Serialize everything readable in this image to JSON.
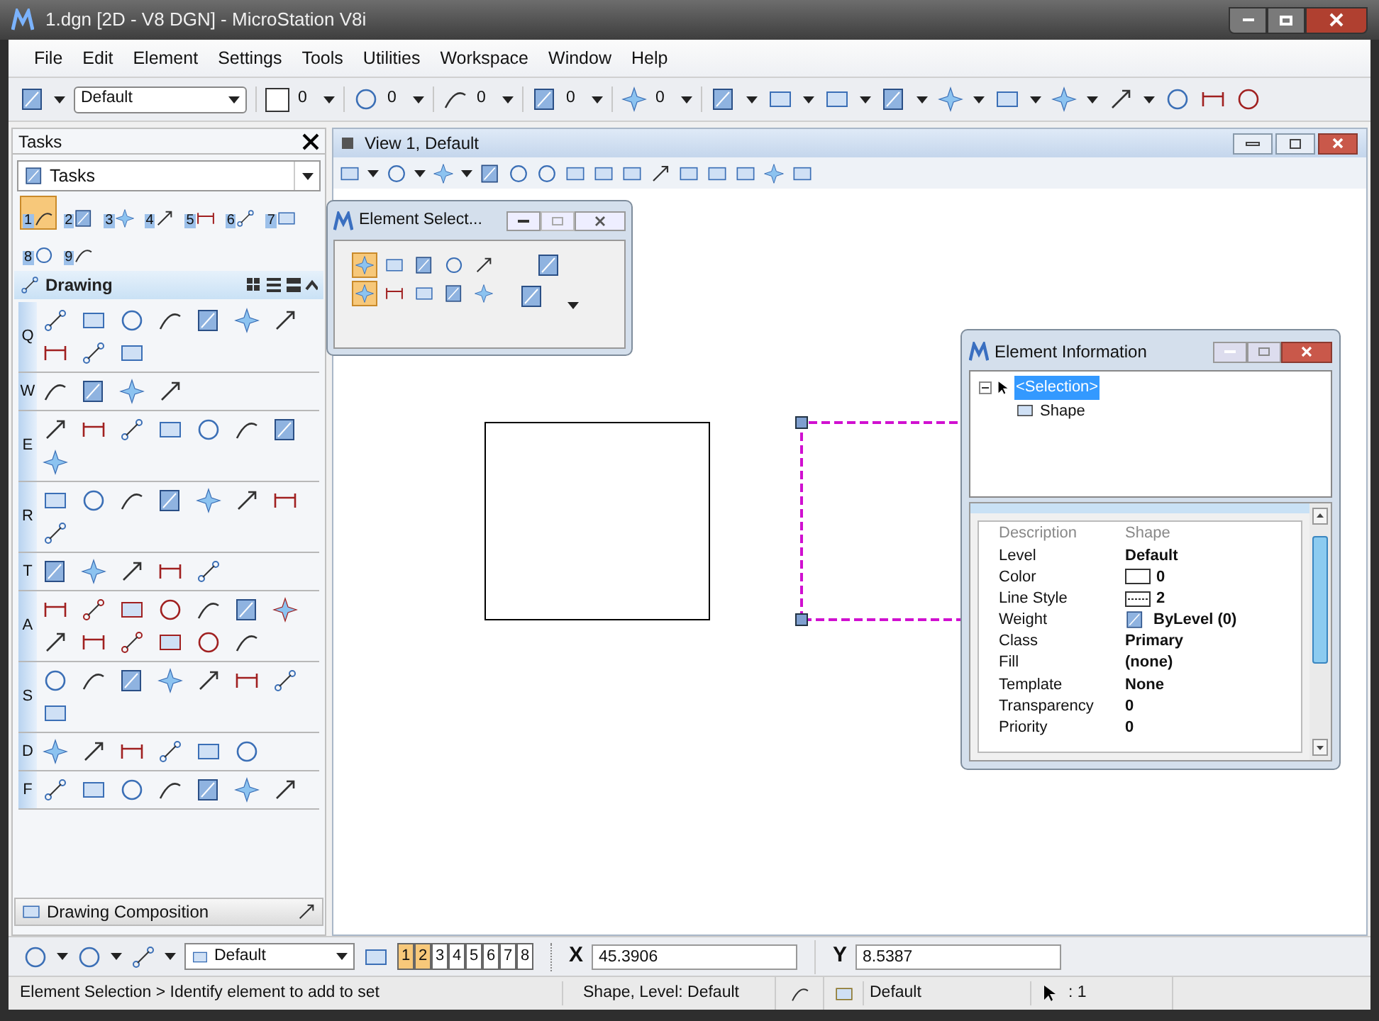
{
  "window": {
    "title": "1.dgn [2D - V8 DGN] - MicroStation V8i"
  },
  "menu": [
    "File",
    "Edit",
    "Element",
    "Settings",
    "Tools",
    "Utilities",
    "Workspace",
    "Window",
    "Help"
  ],
  "attributes": {
    "level": "Default",
    "values": [
      "0",
      "0",
      "0",
      "0",
      "0"
    ]
  },
  "tasks": {
    "title": "Tasks",
    "dropdown": "Tasks",
    "main_tools": [
      {
        "label": "1",
        "selected": true
      },
      {
        "label": "2",
        "selected": false
      },
      {
        "label": "3",
        "selected": false
      },
      {
        "label": "4",
        "selected": false
      },
      {
        "label": "5",
        "selected": false
      },
      {
        "label": "6",
        "selected": false
      },
      {
        "label": "7",
        "selected": false
      },
      {
        "label": "8",
        "selected": false
      },
      {
        "label": "9",
        "selected": false
      }
    ],
    "section": {
      "title": "Drawing",
      "expanded": true,
      "groups": [
        "Q",
        "W",
        "E",
        "R",
        "T",
        "A",
        "S",
        "D",
        "F"
      ]
    },
    "footer": "Drawing Composition"
  },
  "view": {
    "title": "View 1, Default"
  },
  "element_selection": {
    "title": "Element Select...",
    "methods": [
      {
        "selected": true
      },
      {
        "selected": false
      },
      {
        "selected": false
      },
      {
        "selected": false
      },
      {
        "selected": false
      }
    ],
    "modes": [
      {
        "selected": true
      },
      {
        "selected": false
      },
      {
        "selected": false
      },
      {
        "selected": false
      },
      {
        "selected": false
      }
    ]
  },
  "element_info": {
    "title": "Element Information",
    "tree": {
      "label": "<Selection>",
      "selected": true,
      "expanded": true,
      "children": [
        {
          "label": "Shape"
        }
      ]
    },
    "properties": [
      {
        "name": "Description",
        "value": "Shape",
        "kind": "text",
        "disabled": true
      },
      {
        "name": "Level",
        "value": "Default",
        "kind": "text",
        "disabled": false
      },
      {
        "name": "Color",
        "value": "0",
        "kind": "color",
        "disabled": false
      },
      {
        "name": "Line Style",
        "value": "2",
        "kind": "linestyle",
        "disabled": false
      },
      {
        "name": "Weight",
        "value": "ByLevel (0)",
        "kind": "weight",
        "disabled": false
      },
      {
        "name": "Class",
        "value": "Primary",
        "kind": "text",
        "disabled": false
      },
      {
        "name": "Fill",
        "value": "(none)",
        "kind": "text",
        "disabled": false
      },
      {
        "name": "Template",
        "value": "None",
        "kind": "text",
        "disabled": false
      },
      {
        "name": "Transparency",
        "value": "0",
        "kind": "text",
        "disabled": false
      },
      {
        "name": "Priority",
        "value": "0",
        "kind": "text",
        "disabled": false
      }
    ]
  },
  "view_bar": {
    "level": "Default",
    "views": [
      {
        "label": "1",
        "selected": true
      },
      {
        "label": "2",
        "selected": true
      },
      {
        "label": "3",
        "selected": false
      },
      {
        "label": "4",
        "selected": false
      },
      {
        "label": "5",
        "selected": false
      },
      {
        "label": "6",
        "selected": false
      },
      {
        "label": "7",
        "selected": false
      },
      {
        "label": "8",
        "selected": false
      }
    ],
    "x": {
      "label": "X",
      "value": "45.3906"
    },
    "y": {
      "label": "Y",
      "value": "8.5387"
    }
  },
  "status_bar": {
    "prompt": "Element Selection > Identify element to add to set",
    "message": "Shape, Level: Default",
    "level": "Default",
    "count": ": 1"
  }
}
